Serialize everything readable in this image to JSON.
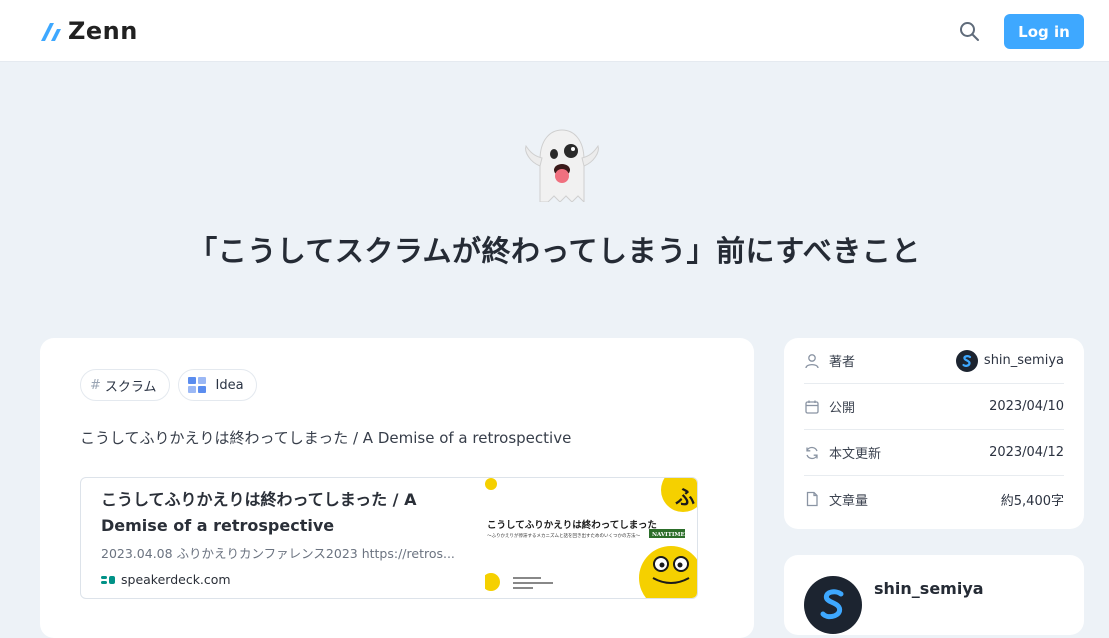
{
  "header": {
    "logo_text": "Zenn",
    "login_label": "Log in",
    "brand_color": "#3ea8ff"
  },
  "article": {
    "emoji": "ghost",
    "title": "「こうしてスクラムが終わってしまう」前にすべきこと",
    "tags": [
      {
        "label": "スクラム",
        "icon": "hash"
      },
      {
        "label": "Idea",
        "icon": "idea-grid-icon"
      }
    ],
    "lead": "こうしてふりかえりは終わってしまった / A Demise of a retrospective",
    "embed": {
      "title": "こうしてふりかえりは終わってしまった / A Demise of a retrospective",
      "description": "2023.04.08 ふりかえりカンファレンス2023 https://retros...",
      "site": "speakerdeck.com",
      "thumb_title": "こうしてふりかえりは終わってしまった",
      "thumb_subtitle": "〜ふりかえりが停滞するメカニズムと話を回き出すためのいくつかの方法〜",
      "thumb_badge": "NAVITIME"
    }
  },
  "info": {
    "rows": [
      {
        "label": "著者",
        "value": "shin_semiya",
        "icon": "user-icon"
      },
      {
        "label": "公開",
        "value": "2023/04/10",
        "icon": "calendar-icon"
      },
      {
        "label": "本文更新",
        "value": "2023/04/12",
        "icon": "refresh-icon"
      },
      {
        "label": "文章量",
        "value": "約5,400字",
        "icon": "document-icon"
      }
    ]
  },
  "author": {
    "name": "shin_semiya"
  }
}
